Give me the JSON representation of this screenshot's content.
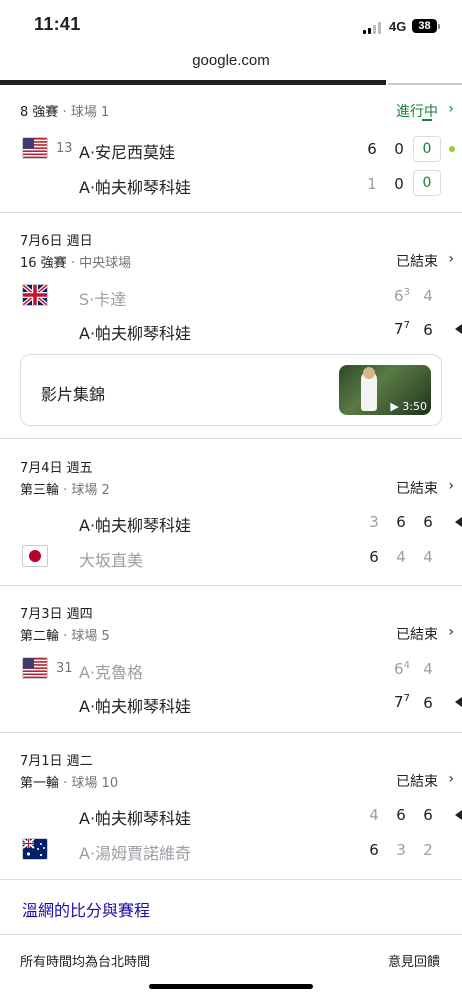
{
  "status_bar": {
    "time": "11:41",
    "network": "4G",
    "battery": "38"
  },
  "browser": {
    "url": "google.com"
  },
  "matches": [
    {
      "date": "",
      "round": "8 強賽",
      "court": "球場 1",
      "status": "進行中",
      "players": [
        {
          "seed": "13",
          "name": "A·安尼西莫娃",
          "flag": "us-flag-icon",
          "scores": [
            "6",
            "0"
          ],
          "live": "0",
          "winner": false
        },
        {
          "seed": "",
          "name": "A·帕夫柳琴科娃",
          "flag": "",
          "scores": [
            "1",
            "0"
          ],
          "live": "0",
          "winner": false
        }
      ]
    },
    {
      "date": "7月6日 週日",
      "round": "16 強賽",
      "court": "中央球場",
      "status": "已結束",
      "players": [
        {
          "seed": "",
          "name": "S·卡達",
          "flag": "uk-flag-icon",
          "scores": [
            "6",
            "4"
          ],
          "tiebreak": [
            "3",
            ""
          ],
          "winner": false
        },
        {
          "seed": "",
          "name": "A·帕夫柳琴科娃",
          "flag": "",
          "scores": [
            "7",
            "6"
          ],
          "tiebreak": [
            "7",
            ""
          ],
          "winner": true
        }
      ],
      "highlight": {
        "label": "影片集錦",
        "duration": "3:50"
      }
    },
    {
      "date": "7月4日 週五",
      "round": "第三輪",
      "court": "球場 2",
      "status": "已結束",
      "players": [
        {
          "seed": "",
          "name": "A·帕夫柳琴科娃",
          "flag": "",
          "scores": [
            "3",
            "6",
            "6"
          ],
          "winner": true
        },
        {
          "seed": "",
          "name": "大坂直美",
          "flag": "japan-flag-icon",
          "scores": [
            "6",
            "4",
            "4"
          ],
          "winner": false
        }
      ]
    },
    {
      "date": "7月3日 週四",
      "round": "第二輪",
      "court": "球場 5",
      "status": "已結束",
      "players": [
        {
          "seed": "31",
          "name": "A·克魯格",
          "flag": "us-flag-icon",
          "scores": [
            "6",
            "4"
          ],
          "tiebreak": [
            "4",
            ""
          ],
          "winner": false
        },
        {
          "seed": "",
          "name": "A·帕夫柳琴科娃",
          "flag": "",
          "scores": [
            "7",
            "6"
          ],
          "tiebreak": [
            "7",
            ""
          ],
          "winner": true
        }
      ]
    },
    {
      "date": "7月1日 週二",
      "round": "第一輪",
      "court": "球場 10",
      "status": "已結束",
      "players": [
        {
          "seed": "",
          "name": "A·帕夫柳琴科娃",
          "flag": "",
          "scores": [
            "4",
            "6",
            "6"
          ],
          "winner": true
        },
        {
          "seed": "",
          "name": "A·湯姆賈諾維奇",
          "flag": "australia-flag-icon",
          "scores": [
            "6",
            "3",
            "2"
          ],
          "winner": false
        }
      ]
    }
  ],
  "links": {
    "wimbledon": "溫網的比分與賽程"
  },
  "footer": {
    "timezone": "所有時間均為台北時間",
    "feedback": "意見回饋"
  },
  "colors": {
    "live_green": "#188038",
    "link_blue": "#1a0dab"
  }
}
